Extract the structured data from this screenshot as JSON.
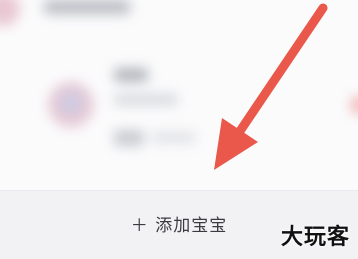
{
  "add_button": {
    "plus_icon": "plus-icon",
    "label": "＋ 添加宝宝"
  },
  "watermark": {
    "text": "大玩客"
  },
  "arrow": {
    "color": "#e9584b"
  },
  "colors": {
    "background": "#f5f5f7",
    "card": "#fbfbfc",
    "text": "#3b3b3f"
  }
}
